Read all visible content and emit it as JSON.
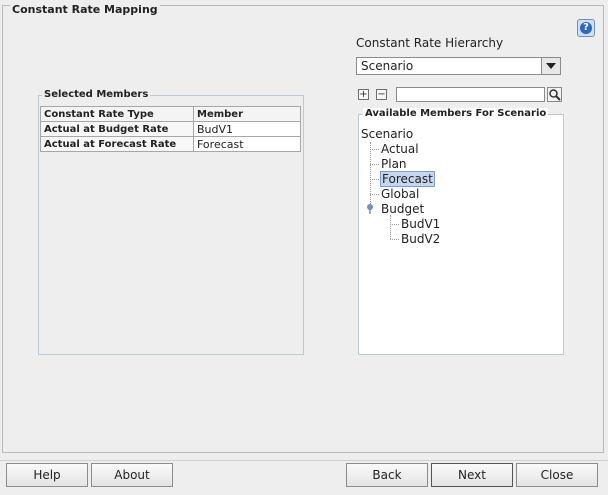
{
  "page": {
    "title": "Constant Rate Mapping"
  },
  "help": {
    "symbol": "?"
  },
  "hierarchy": {
    "label": "Constant Rate Hierarchy",
    "selected": "Scenario",
    "expand_symbol": "+",
    "collapse_symbol": "−",
    "search_value": ""
  },
  "selected_members": {
    "legend": "Selected Members",
    "columns": [
      "Constant Rate Type",
      "Member"
    ],
    "rows": [
      {
        "type": "Actual at Budget Rate",
        "member": "BudV1"
      },
      {
        "type": "Actual at Forecast Rate",
        "member": "Forecast"
      }
    ]
  },
  "available_members": {
    "legend": "Available Members For Scenario",
    "root": "Scenario",
    "items": [
      "Actual",
      "Plan",
      "Forecast",
      "Global",
      "Budget"
    ],
    "children": [
      "BudV1",
      "BudV2"
    ],
    "selected_item": "Forecast"
  },
  "buttons": {
    "help": "Help",
    "about": "About",
    "back": "Back",
    "next": "Next",
    "close": "Close"
  },
  "colors": {
    "background": "#eeeeee",
    "selection": "#c6d6ee",
    "help_icon": "#2e66b8"
  }
}
